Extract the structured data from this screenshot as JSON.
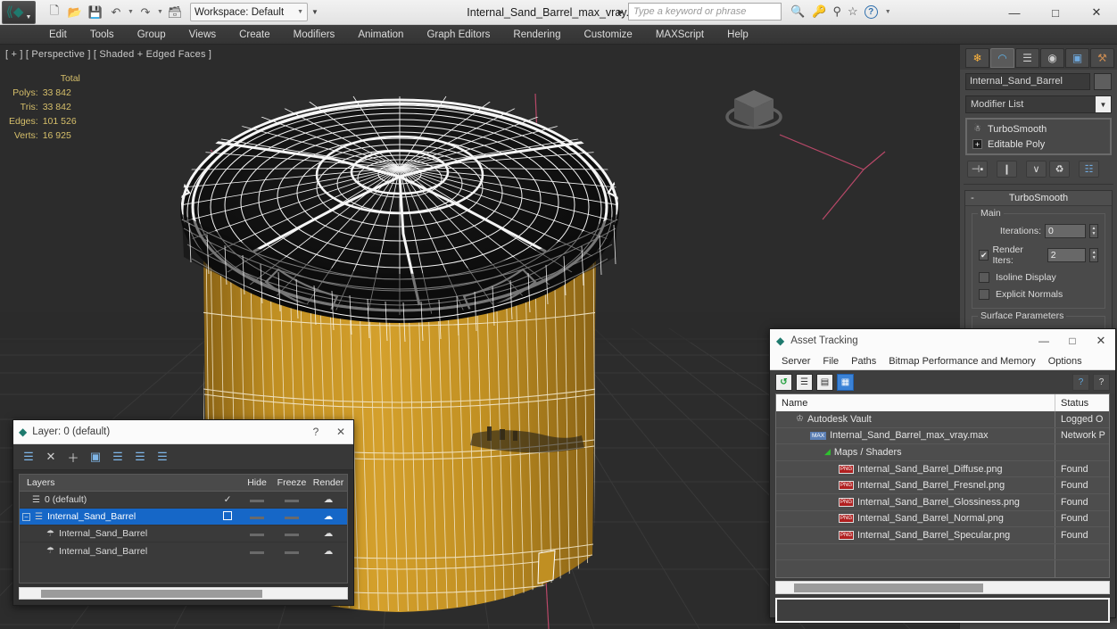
{
  "titlebar": {
    "logo_icon": "autodesk-max-logo",
    "quick_access": [
      {
        "name": "new-file",
        "glyph": "⬜"
      },
      {
        "name": "open-file",
        "glyph": "📂"
      },
      {
        "name": "save-file",
        "glyph": "💾"
      },
      {
        "name": "undo",
        "glyph": "↶"
      },
      {
        "name": "redo",
        "glyph": "↷"
      },
      {
        "name": "project-folder",
        "glyph": "🗂"
      }
    ],
    "workspace_label": "Workspace: Default",
    "document_title": "Internal_Sand_Barrel_max_vray.max",
    "search_placeholder": "Type a keyword or phrase",
    "title_icons": [
      {
        "name": "binoculars-icon",
        "glyph": "♎"
      },
      {
        "name": "key-icon",
        "glyph": "🔑"
      },
      {
        "name": "satellite-icon",
        "glyph": "☂"
      },
      {
        "name": "favorites-star-icon",
        "glyph": "☆"
      }
    ],
    "help_label": "?",
    "window_controls": [
      {
        "name": "minimize-button",
        "glyph": "—"
      },
      {
        "name": "maximize-button",
        "glyph": "☐"
      },
      {
        "name": "close-button",
        "glyph": "✕"
      }
    ]
  },
  "menubar": {
    "items": [
      "Edit",
      "Tools",
      "Group",
      "Views",
      "Create",
      "Modifiers",
      "Animation",
      "Graph Editors",
      "Rendering",
      "Customize",
      "MAXScript",
      "Help"
    ]
  },
  "viewport": {
    "label": "[ + ] [ Perspective ] [ Shaded + Edged Faces ]",
    "stats": {
      "column_header": "Total",
      "rows": [
        {
          "label": "Polys:",
          "value": "33 842"
        },
        {
          "label": "Tris:",
          "value": "33 842"
        },
        {
          "label": "Edges:",
          "value": "101 526"
        },
        {
          "label": "Verts:",
          "value": "16 925"
        }
      ]
    },
    "colors": {
      "background": "#2c2c2c",
      "grid": "#3b3b3b",
      "model_body": "#c89325",
      "model_lid": "#101010",
      "wireframe": "#ffffff",
      "helper_pink": "#c8506e"
    },
    "viewcube_name": "view-cube"
  },
  "command_panel": {
    "tabs": [
      {
        "name": "create-tab",
        "glyph": "☀"
      },
      {
        "name": "modify-tab",
        "glyph": "◠"
      },
      {
        "name": "hierarchy-tab",
        "glyph": "⛓"
      },
      {
        "name": "motion-tab",
        "glyph": "◎"
      },
      {
        "name": "display-tab",
        "glyph": "▣"
      },
      {
        "name": "utilities-tab",
        "glyph": "🔨"
      }
    ],
    "object_name": "Internal_Sand_Barrel",
    "modifier_list_label": "Modifier List",
    "stack": [
      {
        "label": "TurboSmooth",
        "icon": "lightbulb-icon"
      },
      {
        "label": "Editable Poly",
        "icon": "plus-box-icon"
      }
    ],
    "stack_buttons": [
      {
        "name": "pin-stack-button",
        "glyph": "⊣▪"
      },
      {
        "name": "show-end-result-button",
        "glyph": "❙"
      },
      {
        "name": "make-unique-button",
        "glyph": "∨"
      },
      {
        "name": "remove-modifier-button",
        "glyph": "♺"
      },
      {
        "name": "configure-modifier-sets-button",
        "glyph": "⌗"
      }
    ],
    "rollout": {
      "title": "TurboSmooth",
      "collapse_glyph": "-",
      "group_legend": "Main",
      "iterations_label": "Iterations:",
      "iterations_value": "0",
      "render_iters_label": "Render Iters:",
      "render_iters_value": "2",
      "render_iters_checked": true,
      "render_iters_check_glyph": "✔",
      "isoline_display_label": "Isoline Display",
      "isoline_display_checked": false,
      "explicit_normals_label": "Explicit Normals",
      "explicit_normals_checked": false,
      "surface_parameters_legend": "Surface Parameters"
    }
  },
  "layer_dialog": {
    "title": "Layer: 0 (default)",
    "title_icon": "max-layer-icon",
    "help_button": "?",
    "close_button": "✕",
    "toolbar": [
      {
        "name": "create-new-layer-icon",
        "glyph": "≣"
      },
      {
        "name": "delete-layer-icon",
        "glyph": "✕"
      },
      {
        "name": "add-selection-to-layer-icon",
        "glyph": "＋"
      },
      {
        "name": "select-objects-in-layer-icon",
        "glyph": "◰"
      },
      {
        "name": "select-highlighted-objects-icon",
        "glyph": "≣"
      },
      {
        "name": "highlight-selected-objects-icon",
        "glyph": "≣"
      },
      {
        "name": "layer-properties-icon",
        "glyph": "≣"
      }
    ],
    "columns": [
      "Layers",
      "",
      "Hide",
      "Freeze",
      "Render"
    ],
    "rows": [
      {
        "name": "0 (default)",
        "indent": 1,
        "selected": false,
        "check": "✔",
        "hide": "dash",
        "freeze": "dash",
        "render": "render-icon",
        "expander": ""
      },
      {
        "name": "Internal_Sand_Barrel",
        "indent": 0,
        "selected": true,
        "check": "box",
        "hide": "dash",
        "freeze": "dash",
        "render": "render-icon",
        "expander": "-"
      },
      {
        "name": "Internal_Sand_Barrel",
        "indent": 2,
        "selected": false,
        "check": "",
        "hide": "dash",
        "freeze": "dash",
        "render": "render-icon",
        "expander": ""
      },
      {
        "name": "Internal_Sand_Barrel",
        "indent": 2,
        "selected": false,
        "check": "",
        "hide": "dash",
        "freeze": "dash",
        "render": "render-icon",
        "expander": ""
      }
    ]
  },
  "asset_dialog": {
    "title": "Asset Tracking",
    "title_icon": "max-asset-icon",
    "window_controls": [
      {
        "name": "asset-minimize-button",
        "glyph": "—"
      },
      {
        "name": "asset-maximize-button",
        "glyph": "☐"
      },
      {
        "name": "asset-close-button",
        "glyph": "✕"
      }
    ],
    "menus": [
      "Server",
      "File",
      "Paths",
      "Bitmap Performance and Memory",
      "Options"
    ],
    "toolbar": [
      {
        "name": "refresh-icon",
        "glyph": "↻",
        "active": false
      },
      {
        "name": "list-view-icon",
        "glyph": "≣",
        "active": false
      },
      {
        "name": "path-view-icon",
        "glyph": "▤",
        "active": false
      },
      {
        "name": "grid-view-icon",
        "glyph": "▦",
        "active": true
      }
    ],
    "toolbar_right": [
      {
        "name": "help-globe-icon",
        "glyph": "?"
      },
      {
        "name": "context-help-icon",
        "glyph": "?"
      }
    ],
    "columns": [
      "Name",
      "Status"
    ],
    "rows": [
      {
        "name": "Autodesk Vault",
        "status": "Logged O",
        "indent": 1,
        "icon": "vault-icon"
      },
      {
        "name": "Internal_Sand_Barrel_max_vray.max",
        "status": "Network P",
        "indent": 2,
        "icon": "max-file-icon"
      },
      {
        "name": "Maps / Shaders",
        "status": "",
        "indent": 3,
        "icon": "shader-icon"
      },
      {
        "name": "Internal_Sand_Barrel_Diffuse.png",
        "status": "Found",
        "indent": 4,
        "icon": "png-icon"
      },
      {
        "name": "Internal_Sand_Barrel_Fresnel.png",
        "status": "Found",
        "indent": 4,
        "icon": "png-icon"
      },
      {
        "name": "Internal_Sand_Barrel_Glossiness.png",
        "status": "Found",
        "indent": 4,
        "icon": "png-icon"
      },
      {
        "name": "Internal_Sand_Barrel_Normal.png",
        "status": "Found",
        "indent": 4,
        "icon": "png-icon"
      },
      {
        "name": "Internal_Sand_Barrel_Specular.png",
        "status": "Found",
        "indent": 4,
        "icon": "png-icon"
      },
      {
        "name": "",
        "status": "",
        "indent": 0,
        "icon": ""
      },
      {
        "name": "",
        "status": "",
        "indent": 0,
        "icon": ""
      }
    ],
    "status_text": ""
  }
}
